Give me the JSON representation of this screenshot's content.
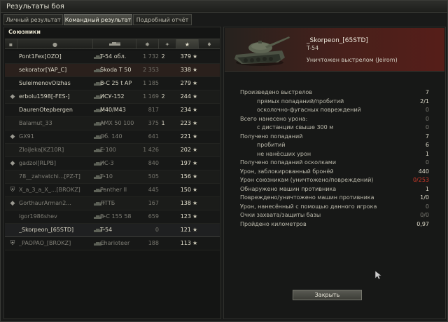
{
  "window": {
    "title": "Результаты боя"
  },
  "tabs": [
    {
      "label": "Личный результат",
      "active": false
    },
    {
      "label": "Командный результат",
      "active": true
    },
    {
      "label": "Подробный отчёт",
      "active": false
    }
  ],
  "allies": {
    "title": "Союзники",
    "columns": [
      {
        "icon": "flag-icon"
      },
      {
        "icon": "player-icon"
      },
      {
        "icon": "tank-icon"
      },
      {
        "icon": "damage-icon"
      },
      {
        "icon": "kills-icon"
      },
      {
        "icon": "star-icon"
      },
      {
        "icon": "medal-icon"
      }
    ],
    "rows": [
      {
        "badge": "",
        "name": "Pont1Fex[OZO]",
        "vehicle": "T-54 обл.",
        "damage": "1 732",
        "kills": "2",
        "xp": "379",
        "dead": false
      },
      {
        "badge": "",
        "name": "sekorator[YAP_C]",
        "vehicle": "Škoda T 50",
        "damage": "2 353",
        "kills": "",
        "xp": "338",
        "dead": false,
        "highlight": true
      },
      {
        "badge": "",
        "name": "SuleimenovOlzhas",
        "vehicle": "В-С 25 t AP",
        "damage": "1 185",
        "kills": "",
        "xp": "279",
        "dead": false
      },
      {
        "badge": "◆",
        "name": "erbolu1598[-FES-]",
        "vehicle": "ИСУ-152",
        "damage": "1 169",
        "kills": "2",
        "xp": "244",
        "dead": false
      },
      {
        "badge": "",
        "name": "DaurenOtepbergen",
        "vehicle": "M40/M43",
        "damage": "817",
        "kills": "",
        "xp": "234",
        "dead": false
      },
      {
        "badge": "",
        "name": "Balamut_33",
        "vehicle": "AMX 50 100",
        "damage": "375",
        "kills": "1",
        "xp": "223",
        "dead": true
      },
      {
        "badge": "◆",
        "name": "GX91",
        "vehicle": "Об. 140",
        "damage": "641",
        "kills": "",
        "xp": "221",
        "dead": true
      },
      {
        "badge": "",
        "name": "ZloiJeka[KZ10R]",
        "vehicle": "E 100",
        "damage": "1 426",
        "kills": "",
        "xp": "202",
        "dead": true
      },
      {
        "badge": "◆",
        "name": "gadzol[RLPB]",
        "vehicle": "ИС-3",
        "damage": "840",
        "kills": "",
        "xp": "197",
        "dead": true
      },
      {
        "badge": "",
        "name": "78__zahvatchi...[PZ-T]",
        "vehicle": "Т-10",
        "damage": "505",
        "kills": "",
        "xp": "156",
        "dead": true
      },
      {
        "badge": "⛨",
        "name": "X_a_3_a_X_...[BROKZ]",
        "vehicle": "Panther II",
        "damage": "445",
        "kills": "",
        "xp": "150",
        "dead": true
      },
      {
        "badge": "◆",
        "name": "GorthaurArman2...",
        "vehicle": "ЛТТБ",
        "damage": "167",
        "kills": "",
        "xp": "138",
        "dead": true
      },
      {
        "badge": "",
        "name": "igor1986shev",
        "vehicle": "В-С 155 58",
        "damage": "659",
        "kills": "",
        "xp": "123",
        "dead": true
      },
      {
        "badge": "",
        "name": "_Skorpeon_[65STD]",
        "vehicle": "T-54",
        "damage": "0",
        "kills": "",
        "xp": "121",
        "dead": false,
        "self": true
      },
      {
        "badge": "⛨",
        "name": "_PAOPAO_[BROKZ]",
        "vehicle": "Charioteer",
        "damage": "188",
        "kills": "",
        "xp": "113",
        "dead": true
      }
    ]
  },
  "player": {
    "name": "_Skorpeon_[65STD]",
    "tank": "T-54",
    "status": "Уничтожен выстрелом (Jeirom)"
  },
  "stats": [
    {
      "label": "Произведено выстрелов",
      "value": "7",
      "indent": false
    },
    {
      "label": "прямых попаданий/пробитий",
      "value": "2/1",
      "indent": true
    },
    {
      "label": "осколочно-фугасных повреждений",
      "value": "0",
      "indent": true,
      "dim": true
    },
    {
      "label": "Всего нанесено урона:",
      "value": "0",
      "indent": false,
      "dim": true
    },
    {
      "label": "с дистанции свыше 300 м",
      "value": "0",
      "indent": true,
      "dim": true
    },
    {
      "label": "Получено попаданий",
      "value": "7",
      "indent": false
    },
    {
      "label": "пробитий",
      "value": "6",
      "indent": true
    },
    {
      "label": "не нанёсших урон",
      "value": "1",
      "indent": true
    },
    {
      "label": "Получено попаданий осколками",
      "value": "0",
      "indent": false,
      "dim": true
    },
    {
      "label": "Урон, заблокированный бронёй",
      "value": "440",
      "indent": false
    },
    {
      "label": "Урон союзникам (уничтожено/повреждений)",
      "value": "0/253",
      "indent": false,
      "red": true
    },
    {
      "label": "Обнаружено машин противника",
      "value": "1",
      "indent": false
    },
    {
      "label": "Повреждено/уничтожено машин противника",
      "value": "1/0",
      "indent": false
    },
    {
      "label": "Урон, нанесённый с помощью данного игрока",
      "value": "0",
      "indent": false,
      "dim": true
    },
    {
      "label": "Очки захвата/защиты базы",
      "value": "0/0",
      "indent": false,
      "dim": true
    },
    {
      "label": "Пройдено километров",
      "value": "0,97",
      "indent": false
    }
  ],
  "close_label": "Закрыть",
  "colors": {
    "accent_red": "#561e19",
    "negative": "#d43a2a"
  }
}
